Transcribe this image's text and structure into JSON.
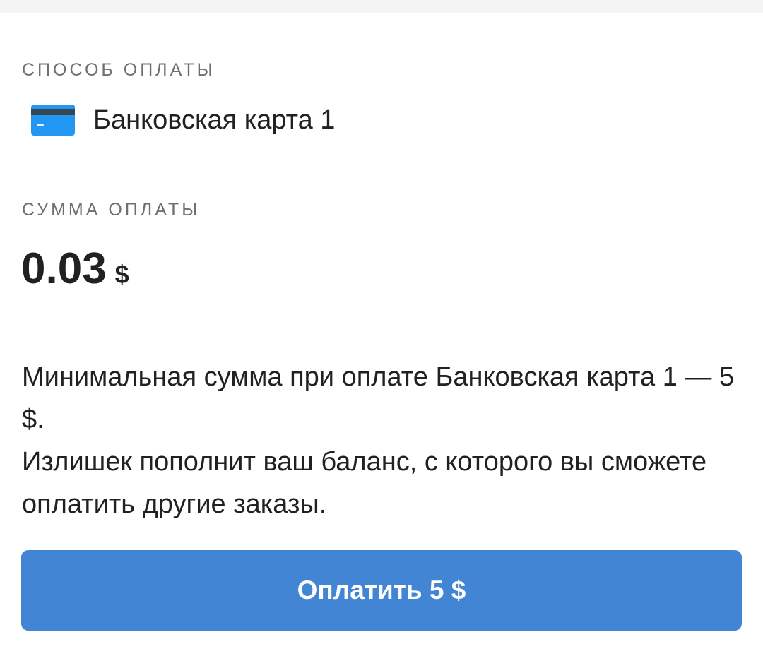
{
  "payment_method": {
    "section_label": "СПОСОБ ОПЛАТЫ",
    "name": "Банковская карта 1",
    "icon": "credit-card-icon"
  },
  "payment_amount": {
    "section_label": "СУММА ОПЛАТЫ",
    "value": "0.03",
    "currency": "$"
  },
  "info": {
    "min_amount_text": "Минимальная сумма при оплате Банковская карта 1 — 5 $.",
    "surplus_text": "Излишек пополнит ваш баланс, с которого вы сможете оплатить другие заказы."
  },
  "pay_button": {
    "label": "Оплатить 5 $"
  },
  "colors": {
    "accent": "#4285d4",
    "card_blue": "#2196f3",
    "card_stripe": "#37474f",
    "label_gray": "#6f6f6f",
    "text": "#212121"
  }
}
